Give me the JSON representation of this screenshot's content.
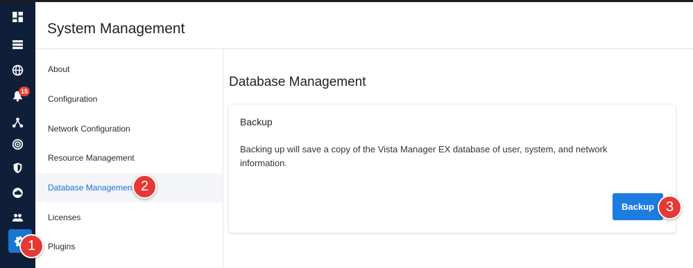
{
  "header": {
    "title": "System Management"
  },
  "rail": {
    "items": [
      {
        "icon": "dashboard-icon"
      },
      {
        "icon": "list-icon"
      },
      {
        "icon": "globe-icon"
      },
      {
        "icon": "bell-icon",
        "badge": "15"
      },
      {
        "icon": "network-topology-icon"
      },
      {
        "icon": "radar-icon"
      },
      {
        "icon": "shield-icon"
      },
      {
        "icon": "cloud-icon"
      },
      {
        "icon": "users-icon"
      },
      {
        "icon": "gear-icon",
        "active": true
      }
    ]
  },
  "subnav": {
    "items": [
      {
        "label": "About"
      },
      {
        "label": "Configuration"
      },
      {
        "label": "Network Configuration"
      },
      {
        "label": "Resource Management"
      },
      {
        "label": "Database Management",
        "active": true
      },
      {
        "label": "Licenses"
      },
      {
        "label": "Plugins"
      }
    ]
  },
  "main": {
    "section_title": "Database Management",
    "card": {
      "title": "Backup",
      "description": "Backing up will save a copy of the Vista Manager EX database of user, system, and network information.",
      "button_label": "Backup"
    }
  },
  "callouts": [
    "1",
    "2",
    "3"
  ],
  "colors": {
    "rail_bg": "#0f1f3a",
    "accent": "#1976d2",
    "active_nav_text": "#1e6fd9",
    "badge": "#e53935",
    "callout": "#e53935"
  }
}
